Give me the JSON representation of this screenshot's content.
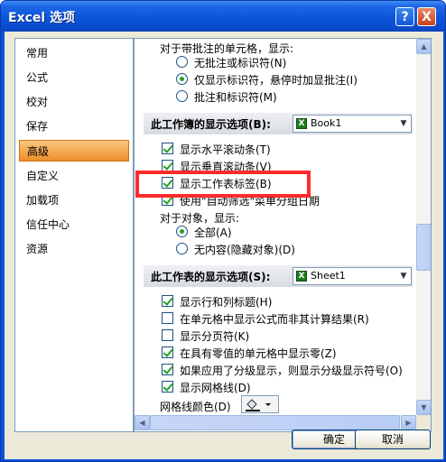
{
  "window": {
    "title": "Excel 选项",
    "help": "?",
    "close": "X"
  },
  "nav": {
    "items": [
      {
        "label": "常用"
      },
      {
        "label": "公式"
      },
      {
        "label": "校对"
      },
      {
        "label": "保存"
      },
      {
        "label": "高级",
        "selected": true
      },
      {
        "label": "自定义"
      },
      {
        "label": "加载项"
      },
      {
        "label": "信任中心"
      },
      {
        "label": "资源"
      }
    ]
  },
  "comments": {
    "heading": "对于带批注的单元格，显示:",
    "options": [
      {
        "label": "无批注或标识符(N)",
        "checked": false
      },
      {
        "label": "仅显示标识符，悬停时加显批注(I)",
        "checked": true
      },
      {
        "label": "批注和标识符(M)",
        "checked": false
      }
    ]
  },
  "workbook_section": {
    "title": "此工作簿的显示选项(B):",
    "combo_value": "Book1",
    "options": [
      {
        "label": "显示水平滚动条(T)",
        "checked": true
      },
      {
        "label": "显示垂直滚动条(V)",
        "checked": true
      },
      {
        "label": "显示工作表标签(B)",
        "checked": true
      },
      {
        "label": "使用\"自动筛选\"菜单分组日期",
        "checked": true
      }
    ]
  },
  "objects": {
    "heading": "对于对象，显示:",
    "options": [
      {
        "label": "全部(A)",
        "checked": true
      },
      {
        "label": "无内容(隐藏对象)(D)",
        "checked": false
      }
    ]
  },
  "sheet_section": {
    "title": "此工作表的显示选项(S):",
    "combo_value": "Sheet1",
    "options": [
      {
        "label": "显示行和列标题(H)",
        "checked": true
      },
      {
        "label": "在单元格中显示公式而非其计算结果(R)",
        "checked": false
      },
      {
        "label": "显示分页符(K)",
        "checked": false
      },
      {
        "label": "在具有零值的单元格中显示零(Z)",
        "checked": true
      },
      {
        "label": "如果应用了分级显示，则显示分级显示符号(O)",
        "checked": true
      },
      {
        "label": "显示网格线(D)",
        "checked": true
      }
    ],
    "gridline_color_label": "网格线颜色(D)"
  },
  "buttons": {
    "ok": "确定",
    "cancel": "取消"
  },
  "colors": {
    "title_bar": "#0b55da",
    "selected_nav": "#f08d2a",
    "highlight": "#ff2a2a",
    "check": "#21a121"
  }
}
